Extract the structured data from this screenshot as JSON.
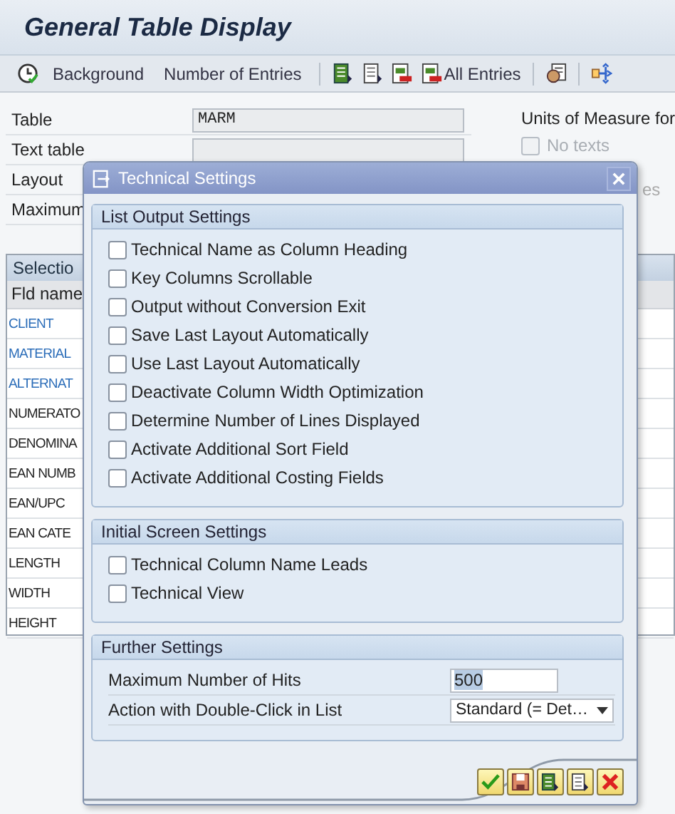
{
  "app": {
    "title": "General Table Display"
  },
  "toolbar": {
    "buttons": [
      {
        "label": "Background"
      },
      {
        "label": "Number of Entries"
      }
    ],
    "all_entries": "All Entries"
  },
  "form": {
    "rows": [
      {
        "label": "Table",
        "kind": "field",
        "value": "MARM"
      },
      {
        "label": "Text table",
        "kind": "field"
      },
      {
        "label": "Layout",
        "kind": "plain"
      },
      {
        "label": "Maximum",
        "kind": "plain"
      }
    ],
    "units_label": "Units of Measure for",
    "no_texts": {
      "label": "No texts",
      "checked": false,
      "disabled": true
    },
    "partial": "es"
  },
  "table": {
    "header": "Selectio",
    "column": "Fld name",
    "rows": [
      {
        "name": "CLIENT",
        "key": true
      },
      {
        "name": "MATERIAL",
        "key": true
      },
      {
        "name": "ALTERNAT",
        "key": true
      },
      {
        "name": "NUMERATO",
        "key": false
      },
      {
        "name": "DENOMINA",
        "key": false
      },
      {
        "name": "EAN NUMB",
        "key": false
      },
      {
        "name": "EAN/UPC",
        "key": false
      },
      {
        "name": "EAN CATE",
        "key": false
      },
      {
        "name": "LENGTH",
        "key": false
      },
      {
        "name": "WIDTH",
        "key": false
      },
      {
        "name": "HEIGHT",
        "key": false
      }
    ]
  },
  "dialog": {
    "title": "Technical Settings",
    "groups": [
      {
        "title": "List Output Settings",
        "items": [
          {
            "kind": "checkbox",
            "label": "Technical Name as Column Heading",
            "checked": false
          },
          {
            "kind": "checkbox",
            "label": "Key Columns Scrollable",
            "checked": false
          },
          {
            "kind": "checkbox",
            "label": "Output without Conversion Exit",
            "checked": false
          },
          {
            "kind": "checkbox",
            "label": "Save Last Layout Automatically",
            "checked": false
          },
          {
            "kind": "checkbox",
            "label": "Use Last Layout Automatically",
            "checked": false
          },
          {
            "kind": "checkbox",
            "label": "Deactivate Column Width Optimization",
            "checked": false
          },
          {
            "kind": "checkbox",
            "label": "Determine Number of Lines Displayed",
            "checked": false
          },
          {
            "kind": "checkbox",
            "label": "Activate Additional Sort Field",
            "checked": false
          },
          {
            "kind": "checkbox",
            "label": "Activate Additional Costing Fields",
            "checked": false
          }
        ]
      },
      {
        "title": "Initial Screen Settings",
        "items": [
          {
            "kind": "checkbox",
            "label": "Technical Column Name Leads",
            "checked": false
          },
          {
            "kind": "checkbox",
            "label": "Technical View",
            "checked": false
          }
        ]
      },
      {
        "title": "Further Settings",
        "items": [
          {
            "kind": "input",
            "label": "Maximum Number of Hits",
            "value": "500"
          },
          {
            "kind": "dropdown",
            "label": "Action with Double-Click in List",
            "value": "Standard (= Det…"
          }
        ]
      }
    ]
  }
}
